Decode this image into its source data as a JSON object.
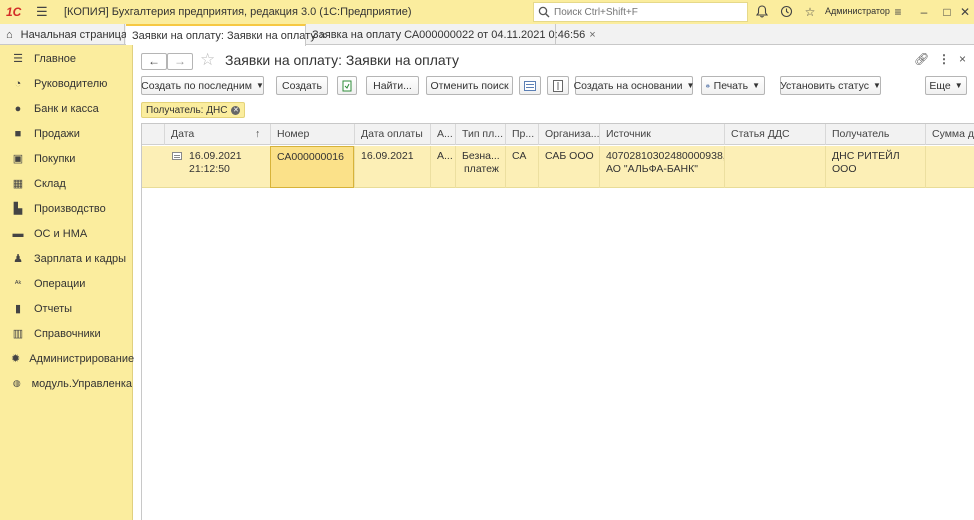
{
  "titlebar": {
    "logo": "1С",
    "title": "[КОПИЯ] Бухгалтерия предприятия, редакция 3.0  (1С:Предприятие)",
    "search_placeholder": "Поиск Ctrl+Shift+F",
    "user": "Администратор"
  },
  "tabs": [
    {
      "label": "Начальная страница"
    },
    {
      "label": "Заявки на оплату: Заявки на оплату"
    },
    {
      "label": "Заявка на оплату СА000000022 от 04.11.2021 0:46:56"
    }
  ],
  "sidebar": {
    "items": [
      {
        "label": "Главное",
        "icon": "menu-icon"
      },
      {
        "label": "Руководителю",
        "icon": "chart-icon"
      },
      {
        "label": "Банк и касса",
        "icon": "coin-icon"
      },
      {
        "label": "Продажи",
        "icon": "bag-icon"
      },
      {
        "label": "Покупки",
        "icon": "cart-icon"
      },
      {
        "label": "Склад",
        "icon": "warehouse-icon"
      },
      {
        "label": "Производство",
        "icon": "factory-icon"
      },
      {
        "label": "ОС и НМА",
        "icon": "truck-icon"
      },
      {
        "label": "Зарплата и кадры",
        "icon": "person-icon"
      },
      {
        "label": "Операции",
        "icon": "operations-icon"
      },
      {
        "label": "Отчеты",
        "icon": "bars-icon"
      },
      {
        "label": "Справочники",
        "icon": "books-icon"
      },
      {
        "label": "Администрирование",
        "icon": "gear-icon"
      },
      {
        "label": "модуль.Управленка",
        "icon": "module-icon"
      }
    ]
  },
  "page": {
    "title": "Заявки на оплату: Заявки на оплату"
  },
  "toolbar": {
    "create_by_last": "Создать по последним",
    "create": "Создать",
    "find": "Найти...",
    "cancel_search": "Отменить поиск",
    "create_based_on": "Создать на основании",
    "print": "Печать",
    "set_status": "Установить статус",
    "more": "Еще"
  },
  "filter": {
    "label": "Получатель: ДНС"
  },
  "table": {
    "columns": [
      "Дата",
      "Номер",
      "Дата оплаты",
      "А...",
      "Тип пл...",
      "Пр...",
      "Организа...",
      "Источник",
      "Статья ДДС",
      "Получатель",
      "Сумма д"
    ],
    "rows": [
      {
        "date": "16.09.2021",
        "time": "21:12:50",
        "number": "СА000000016",
        "pay_date": "16.09.2021",
        "a": "А...",
        "type_line1": "Безна...",
        "type_line2": "платеж",
        "pr": "СА",
        "org": "САБ ООО",
        "source_line1": "40702810302480000938,",
        "source_line2": "АО \"АЛЬФА-БАНК\"",
        "dds": "",
        "recipient": "ДНС РИТЕЙЛ ООО",
        "sum": ""
      }
    ]
  }
}
